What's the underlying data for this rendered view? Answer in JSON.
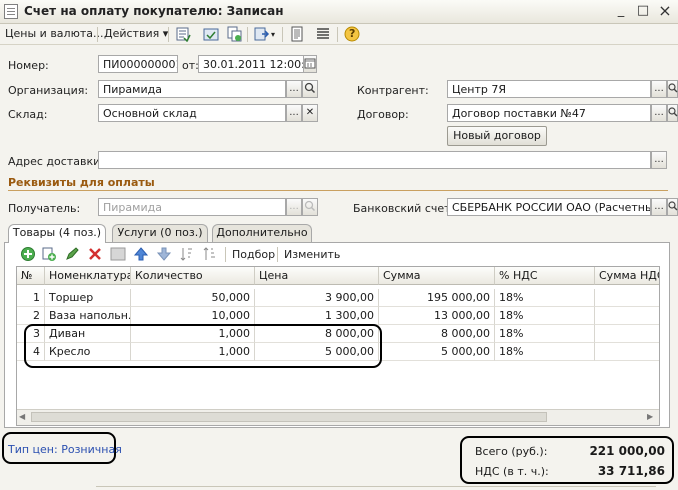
{
  "window": {
    "title": "Счет на оплату покупателю: Записан",
    "minimize": "_",
    "maximize": "□",
    "close": "×"
  },
  "toolbar": {
    "prices_label": "Цены и валюта...",
    "actions_label": "Действия",
    "actions_arrow": "▾",
    "help": "?"
  },
  "header": {
    "number_label": "Номер:",
    "number_value": "ПИ000000001",
    "date_label": "от:",
    "date_value": "30.01.2011 12:00:00",
    "org_label": "Организация:",
    "org_value": "Пирамида",
    "warehouse_label": "Склад:",
    "warehouse_value": "Основной склад",
    "counterparty_label": "Контрагент:",
    "counterparty_value": "Центр 7Я",
    "contract_label": "Договор:",
    "contract_value": "Договор поставки №47",
    "new_contract_button": "Новый договор",
    "address_label": "Адрес доставки:",
    "address_value": ""
  },
  "payment": {
    "section_title": "Реквизиты для оплаты",
    "recipient_label": "Получатель:",
    "recipient_value": "Пирамида",
    "bank_label": "Банковский счет:",
    "bank_value": "СБЕРБАНК РОССИИ ОАО (Расчетный)"
  },
  "tabs": [
    {
      "label": "Товары (4 поз.)",
      "active": true
    },
    {
      "label": "Услуги (0 поз.)",
      "active": false
    },
    {
      "label": "Дополнительно",
      "active": false
    }
  ],
  "table_toolbar": {
    "pick_label": "Подбор",
    "change_label": "Изменить"
  },
  "table": {
    "columns": [
      "№",
      "Номенклатура",
      "Количество",
      "Цена",
      "Сумма",
      "% НДС",
      "Сумма НДС"
    ],
    "rows": [
      [
        "1",
        "Торшер",
        "50,000",
        "3 900,00",
        "195 000,00",
        "18%",
        ""
      ],
      [
        "2",
        "Ваза напольн...",
        "10,000",
        "1 300,00",
        "13 000,00",
        "18%",
        ""
      ],
      [
        "3",
        "Диван",
        "1,000",
        "8 000,00",
        "8 000,00",
        "18%",
        ""
      ],
      [
        "4",
        "Кресло",
        "1,000",
        "5 000,00",
        "5 000,00",
        "18%",
        ""
      ]
    ]
  },
  "footer": {
    "price_type": "Тип цен: Розничная",
    "total_label": "Всего (руб.):",
    "total_value": "221 000,00",
    "vat_label": "НДС (в т. ч.):",
    "vat_value": "33 711,86"
  },
  "colors": {
    "section": "#9a5a10",
    "link": "#2a4fb0",
    "grid_selected": "#ffffff"
  }
}
